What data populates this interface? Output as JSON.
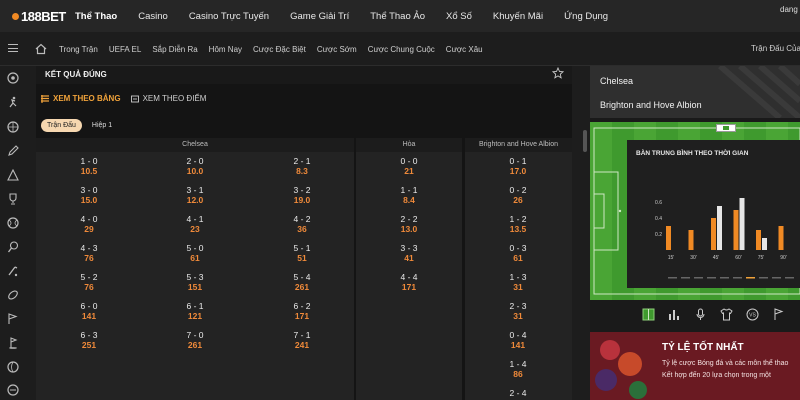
{
  "brand": {
    "logo_text": "188BET",
    "accent": "#f08a24"
  },
  "top_nav": {
    "items": [
      {
        "label": "Thể Thao",
        "active": true
      },
      {
        "label": "Casino",
        "active": false
      },
      {
        "label": "Casino Trực Tuyến",
        "active": false
      },
      {
        "label": "Game Giải Trí",
        "active": false
      },
      {
        "label": "Thể Thao Ảo",
        "active": false
      },
      {
        "label": "Xổ Số",
        "active": false
      },
      {
        "label": "Khuyến Mãi",
        "active": false
      },
      {
        "label": "Ứng Dụng",
        "active": false
      }
    ],
    "user": "dang"
  },
  "sub_nav": {
    "items": [
      "Trong Trận",
      "UEFA EL",
      "Sắp Diễn Ra",
      "Hôm Nay",
      "Cược Đặc Biệt",
      "Cược Sớm",
      "Cược Chung Cuộc",
      "Cược Xâu"
    ],
    "right_label": "Trận Đấu Của T"
  },
  "sidebar": {
    "icons": [
      "soccer-ball-icon",
      "runner-icon",
      "basketball-icon",
      "pencil-icon",
      "warning-icon",
      "trophy-icon",
      "tennis-icon",
      "racket-icon",
      "hockey-icon",
      "football-icon",
      "flag-icon",
      "golf-icon",
      "volleyball-icon",
      "esports-icon"
    ]
  },
  "market": {
    "title": "KẾT QUẢ ĐÚNG",
    "view_tabs": [
      {
        "label": "XEM THEO BẢNG",
        "active": true
      },
      {
        "label": "XEM THEO ĐIỂM",
        "active": false
      }
    ],
    "period_tabs": [
      {
        "label": "Trận Đấu",
        "active": true
      },
      {
        "label": "Hiệp 1",
        "active": false
      }
    ],
    "columns": {
      "home": "Chelsea",
      "draw": "Hòa",
      "away": "Brighton and Hove Albion"
    },
    "home_cells": [
      [
        {
          "s": "1 - 0",
          "o": "10.5"
        },
        {
          "s": "2 - 0",
          "o": "10.0"
        },
        {
          "s": "2 - 1",
          "o": "8.3"
        }
      ],
      [
        {
          "s": "3 - 0",
          "o": "15.0"
        },
        {
          "s": "3 - 1",
          "o": "12.0"
        },
        {
          "s": "3 - 2",
          "o": "19.0"
        }
      ],
      [
        {
          "s": "4 - 0",
          "o": "29"
        },
        {
          "s": "4 - 1",
          "o": "23"
        },
        {
          "s": "4 - 2",
          "o": "36"
        }
      ],
      [
        {
          "s": "4 - 3",
          "o": "76"
        },
        {
          "s": "5 - 0",
          "o": "61"
        },
        {
          "s": "5 - 1",
          "o": "51"
        }
      ],
      [
        {
          "s": "5 - 2",
          "o": "76"
        },
        {
          "s": "5 - 3",
          "o": "151"
        },
        {
          "s": "5 - 4",
          "o": "261"
        }
      ],
      [
        {
          "s": "6 - 0",
          "o": "141"
        },
        {
          "s": "6 - 1",
          "o": "121"
        },
        {
          "s": "6 - 2",
          "o": "171"
        }
      ],
      [
        {
          "s": "6 - 3",
          "o": "251"
        },
        {
          "s": "7 - 0",
          "o": "261"
        },
        {
          "s": "7 - 1",
          "o": "241"
        }
      ]
    ],
    "draw_cells": [
      {
        "s": "0 - 0",
        "o": "21"
      },
      {
        "s": "1 - 1",
        "o": "8.4"
      },
      {
        "s": "2 - 2",
        "o": "13.0"
      },
      {
        "s": "3 - 3",
        "o": "41"
      },
      {
        "s": "4 - 4",
        "o": "171"
      }
    ],
    "away_cells": [
      {
        "s": "0 - 1",
        "o": "17.0"
      },
      {
        "s": "0 - 2",
        "o": "26"
      },
      {
        "s": "1 - 2",
        "o": "13.5"
      },
      {
        "s": "0 - 3",
        "o": "61"
      },
      {
        "s": "1 - 3",
        "o": "31"
      },
      {
        "s": "2 - 3",
        "o": "31"
      },
      {
        "s": "0 - 4",
        "o": "141"
      },
      {
        "s": "1 - 4",
        "o": "86"
      },
      {
        "s": "2 - 4",
        "o": ""
      }
    ]
  },
  "match": {
    "home": "Chelsea",
    "away": "Brighton and Hove Albion"
  },
  "stats": {
    "title": "BÀN TRUNG BÌNH THEO THỜI GIAN",
    "chart_data": {
      "type": "bar",
      "title": "BÀN TRUNG BÌNH THEO THỜI GIAN",
      "categories": [
        "15'",
        "30'",
        "45'",
        "60'",
        "75'",
        "90'"
      ],
      "y_ticks": [
        "0.6",
        "0.4",
        "0.2"
      ],
      "ylim": [
        0,
        0.7
      ],
      "series": [
        {
          "values": [
            0.3,
            0.25,
            0.4,
            0.5,
            0.25,
            0.3
          ],
          "color": "#f08a24"
        },
        {
          "values": [
            0.0,
            0.0,
            0.55,
            0.65,
            0.15,
            0.0
          ],
          "color": "#e6e6e6"
        }
      ]
    }
  },
  "tools": {
    "icons": [
      "field-icon",
      "stats-icon",
      "microphone-icon",
      "jersey-icon",
      "versus-icon",
      "flag-icon"
    ]
  },
  "promo": {
    "title": "TỶ LỆ TỐT NHẤT",
    "line1": "Tỷ lệ cược Bóng đá và các môn thể thao",
    "line2": "Kết hợp đến 20 lựa chọn trong một"
  },
  "colors": {
    "odds": "#f08a3a",
    "active_tab": "#f0a23a",
    "pitch": "#3f9a2e",
    "promo": "#6a1a22"
  }
}
